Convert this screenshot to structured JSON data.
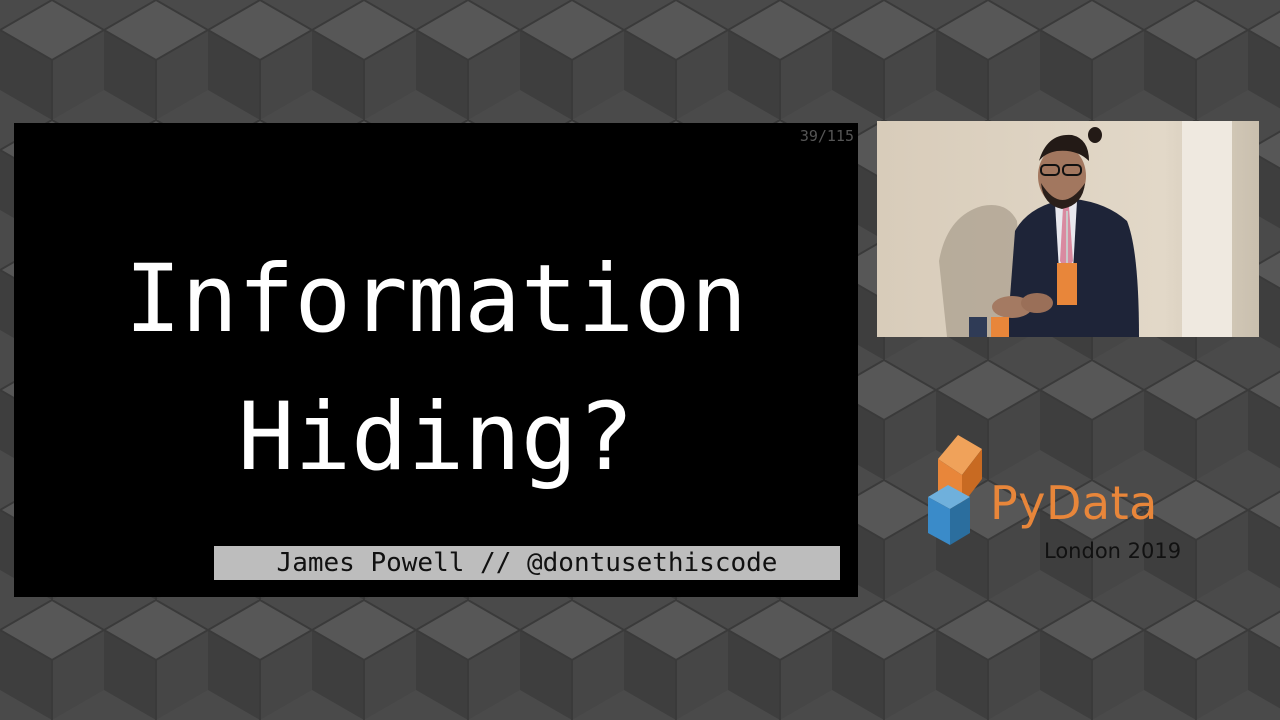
{
  "slide": {
    "counter": "39/115",
    "title_line1": "Information",
    "title_line2": "Hiding?",
    "byline": "James Powell // @dontusethiscode"
  },
  "logo": {
    "wordmark": "PyData",
    "event": "London 2019",
    "colors": {
      "orange": "#e8863a",
      "blue": "#3a8bc9"
    }
  },
  "camera": {
    "icon": "speaker-video-feed"
  },
  "colors": {
    "background": "#4a4a4a",
    "slide": "#000000",
    "byline_bg": "#bdbdbd"
  }
}
